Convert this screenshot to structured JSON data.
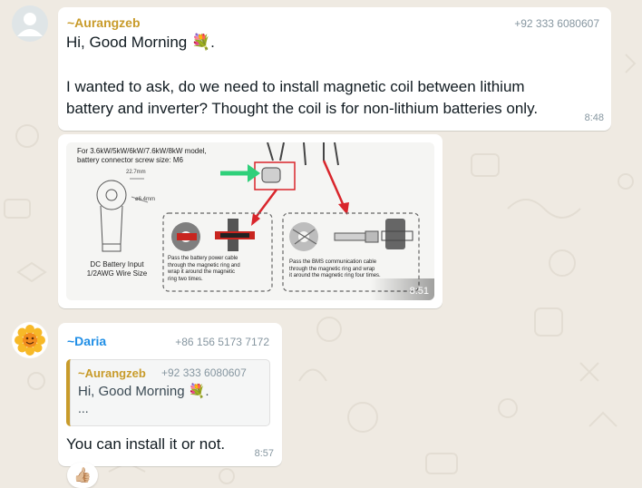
{
  "colors": {
    "aurangzeb_name": "#c89b2a",
    "daria_name": "#1f8ee6",
    "bubble": "#ffffff",
    "wallpaper": "#efeae2"
  },
  "messages": [
    {
      "sender": "~Aurangzeb",
      "phone": "+92 333 6080607",
      "line1": "Hi, Good Morning 💐.",
      "line2": "I wanted to ask, do we need to install magnetic coil between lithium",
      "line3": "battery and inverter? Thought the coil is for non-lithium batteries only.",
      "time": "8:48"
    },
    {
      "image": {
        "caption_top_1": "For 3.6kW/5kW/6kW/7.6kW/8kW model,",
        "caption_top_2": "battery connector screw size: M6",
        "dim_1": "22.7mm",
        "dim_2": "ø6.4mm",
        "dc_label_1": "DC Battery Input",
        "dc_label_2": "1/2AWG Wire Size",
        "left_note_1": "Pass the battery power cable",
        "left_note_2": "through the magnetic ring and",
        "left_note_3": "wrap it around the magnetic",
        "left_note_4": "ring two times.",
        "right_note_1": "Pass the BMS communication cable",
        "right_note_2": "through the magnetic ring and wrap",
        "right_note_3": "it around the magnetic ring four times."
      },
      "time": "8:51"
    },
    {
      "sender": "~Daria",
      "phone": "+86 156 5173 7172",
      "reply": {
        "sender": "~Aurangzeb",
        "phone": "+92 333 6080607",
        "line1": "Hi, Good Morning 💐.",
        "line2": "..."
      },
      "text": "You can install it or not.",
      "time": "8:57",
      "reaction": "👍🏼"
    }
  ]
}
